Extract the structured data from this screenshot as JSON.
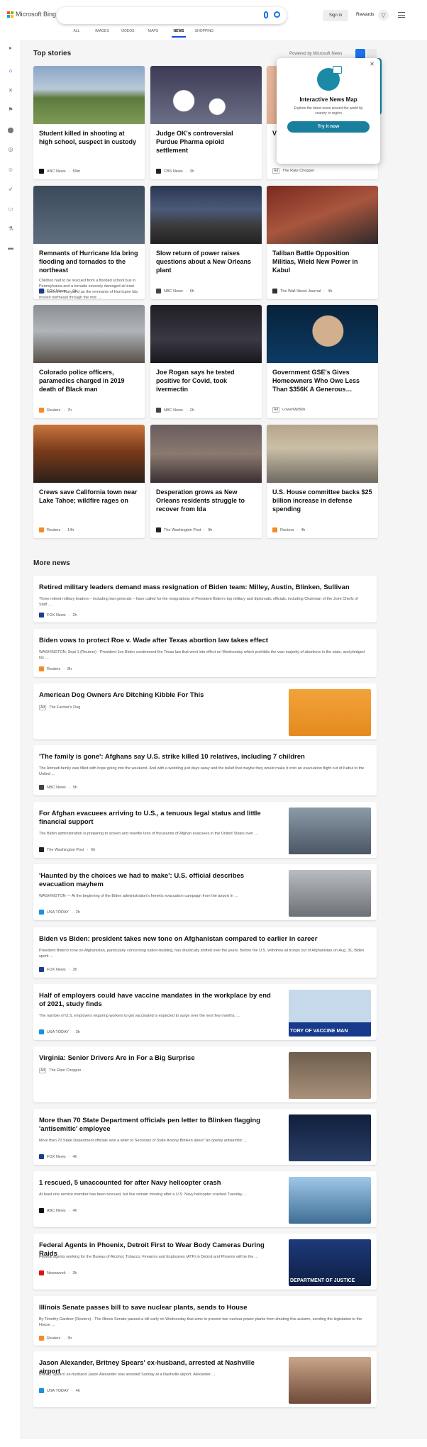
{
  "header": {
    "brand": "Microsoft Bing",
    "signin_label": "Sign in",
    "rewards_label": "Rewards",
    "nav": [
      {
        "label": "ALL",
        "active": false
      },
      {
        "label": "IMAGES",
        "active": false
      },
      {
        "label": "VIDEOS",
        "active": false
      },
      {
        "label": "MAPS",
        "active": false
      },
      {
        "label": "NEWS",
        "active": true
      },
      {
        "label": "SHOPPING",
        "active": false
      }
    ]
  },
  "rail_icons": [
    "expand-icon",
    "home-icon",
    "discover-icon",
    "flag-icon",
    "location-icon",
    "globe-icon",
    "person-icon",
    "rocket-icon",
    "film-icon",
    "lab-icon",
    "card-icon"
  ],
  "top_stories": {
    "heading": "Top stories",
    "powered_by": "Powered by Microsoft News",
    "cards": [
      {
        "title": "Student killed in shooting at high school, suspect in custody",
        "desc": "",
        "source": "ABC News",
        "age": "59m",
        "ad": false
      },
      {
        "title": "Judge OK's controversial Purdue Pharma opioid settlement",
        "desc": "",
        "source": "CBS News",
        "age": "3h",
        "ad": false
      },
      {
        "title": "Virgi… For a…",
        "desc": "",
        "source": "The Rate Chopper",
        "age": "",
        "ad": true
      },
      {
        "title": "Remnants of Hurricane Ida bring flooding and tornados to the northeast",
        "desc": "Children had to be rescued from a flooded school bus in Pennsylvania and a tornado severely damaged at least 100 homes in Maryland as the remnants of Hurricane Ida moved northeast through the mid …",
        "source": "FOX News",
        "age": "1h",
        "ad": false
      },
      {
        "title": "Slow return of power raises questions about a New Orleans plant",
        "desc": "",
        "source": "NBC News",
        "age": "6h",
        "ad": false
      },
      {
        "title": "Taliban Battle Opposition Militias, Wield New Power in Kabul",
        "desc": "",
        "source": "The Wall Street Journal",
        "age": "4h",
        "ad": false
      },
      {
        "title": "Colorado police officers, paramedics charged in 2019 death of Black man",
        "desc": "",
        "source": "Reuters",
        "age": "7h",
        "ad": false
      },
      {
        "title": "Joe Rogan says he tested positive for Covid, took ivermectin",
        "desc": "",
        "source": "NBC News",
        "age": "2h",
        "ad": false
      },
      {
        "title": "Government GSE's Gives Homeowners Who Owe Less Than $356K A Generous…",
        "desc": "",
        "source": "LowerMyBills",
        "age": "",
        "ad": true
      },
      {
        "title": "Crews save California town near Lake Tahoe; wildfire rages on",
        "desc": "",
        "source": "Reuters",
        "age": "14h",
        "ad": false
      },
      {
        "title": "Desperation grows as New Orleans residents struggle to recover from Ida",
        "desc": "",
        "source": "The Washington Post",
        "age": "9h",
        "ad": false
      },
      {
        "title": "U.S. House committee backs $25 billion increase in defense spending",
        "desc": "",
        "source": "Reuters",
        "age": "4h",
        "ad": false
      }
    ]
  },
  "popup": {
    "title": "Interactive News Map",
    "desc": "Explore the latest news around the world by country or region",
    "button": "Try it now"
  },
  "more_news": {
    "heading": "More news",
    "items": [
      {
        "title": "Retired military leaders demand mass resignation of Biden team: Milley, Austin, Blinken, Sullivan",
        "desc": "Three retired military leaders – including two generals – have called for the resignations of President Biden's top military and diplomatic officials, including Chairman of the Joint Chiefs of Staff …",
        "source": "FOX News",
        "age": "2h",
        "ad": false
      },
      {
        "title": "Biden vows to protect Roe v. Wade after Texas abortion law takes effect",
        "desc": "WASHINGTON, Sept 1 (Reuters) - President Joe Biden condemned the Texas law that went into effect on Wednesday which prohibits the vast majority of abortions in the state, and pledged his …",
        "source": "Reuters",
        "age": "8h",
        "ad": false
      },
      {
        "title": "American Dog Owners Are Ditching Kibble For This",
        "desc": "",
        "source": "The Farmer's Dog",
        "age": "",
        "ad": true
      },
      {
        "title": "'The family is gone': Afghans say U.S. strike killed 10 relatives, including 7 children",
        "desc": "The Ahmadi family was filled with hope going into the weekend. And with a wedding just days away and the belief that maybe they would make it onto an evacuation flight out of Kabul to the United …",
        "source": "NBC News",
        "age": "9h",
        "ad": false
      },
      {
        "title": "For Afghan evacuees arriving to U.S., a tenuous legal status and little financial support",
        "desc": "The Biden administration is preparing to screen and resettle tens of thousands of Afghan evacuees in the United States over …",
        "source": "The Washington Post",
        "age": "6h",
        "ad": false
      },
      {
        "title": "'Haunted by the choices we had to make': U.S. official describes evacuation mayhem",
        "desc": "WASHINGTON — At the beginning of the Biden administration's frenetic evacuation campaign from the airport in …",
        "source": "USA TODAY",
        "age": "2h",
        "ad": false
      },
      {
        "title": "Biden vs Biden: president takes new tone on Afghanistan compared to earlier in career",
        "desc": "President Biden's tone on Afghanistan, particularly concerning nation-building, has drastically shifted over the years. Before the U.S. withdrew all troops out of Afghanistan on Aug. 31, Biden spent …",
        "source": "FOX News",
        "age": "3h",
        "ad": false
      },
      {
        "title": "Half of employers could have vaccine mandates in the workplace by end of 2021, study finds",
        "desc": "The number of U.S. employers requiring workers to get vaccinated is expected to surge over the next few months, …",
        "source": "USA TODAY",
        "age": "3h",
        "ad": false,
        "thumb_text": "TORY OF VACCINE MAN"
      },
      {
        "title": "Virginia: Senior Drivers Are in For a Big Surprise",
        "desc": "",
        "source": "The Rate Chopper",
        "age": "",
        "ad": true
      },
      {
        "title": "More than 70 State Department officials pen letter to Blinken flagging 'antisemitic' employee",
        "desc": "More than 70 State Department officials sent a letter to Secretary of State Antony Blinken about \"an openly antisemitic …",
        "source": "FOX News",
        "age": "4h",
        "ad": false
      },
      {
        "title": "1 rescued, 5 unaccounted for after Navy helicopter crash",
        "desc": "At least one service member has been rescued, but five remain missing after a U.S. Navy helicopter crashed Tuesday …",
        "source": "ABC News",
        "age": "4h",
        "ad": false
      },
      {
        "title": "Federal Agents in Phoenix, Detroit First to Wear Body Cameras During Raids",
        "desc": "Federal agents working for the Bureau of Alcohol, Tobacco, Firearms and Explosives (ATF) in Detroit and Phoenix will be the …",
        "source": "Newsweek",
        "age": "3h",
        "ad": false,
        "thumb_text": "DEPARTMENT OF JUSTICE"
      },
      {
        "title": "Illinois Senate passes bill to save nuclear plants, sends to House",
        "desc": "By Timothy Gardner (Reuters) - The Illinois Senate passed a bill early on Wednesday that aims to prevent two nuclear power plants from shutting this autumn, sending the legislation to the House …",
        "source": "Reuters",
        "age": "3h",
        "ad": false
      },
      {
        "title": "Jason Alexander, Britney Spears' ex-husband, arrested at Nashville airport",
        "desc": "Britney Spears' ex-husband Jason Alexander was arrested Sunday at a Nashville airport. Alexander, …",
        "source": "USA TODAY",
        "age": "4h",
        "ad": false
      }
    ]
  },
  "ad_label": "Ad",
  "colors": {
    "accent": "#174ae4",
    "teal": "#1a7e9e",
    "page_bg": "#f5f5f5"
  }
}
